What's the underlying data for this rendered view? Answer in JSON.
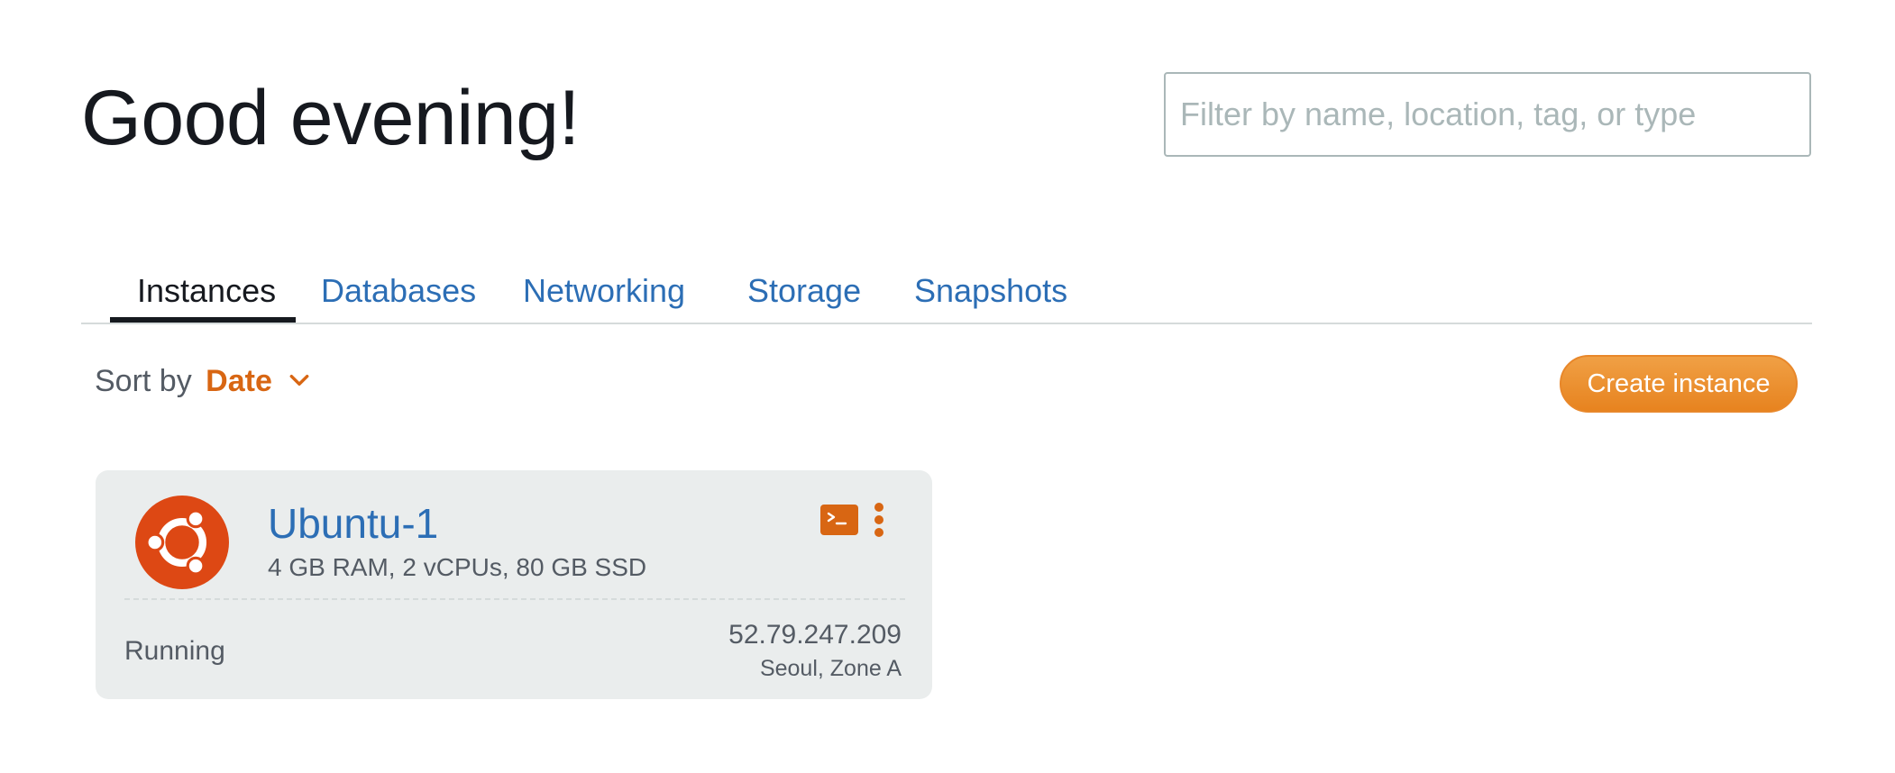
{
  "header": {
    "greeting": "Good evening!"
  },
  "filter": {
    "placeholder": "Filter by name, location, tag, or type",
    "value": ""
  },
  "tabs": [
    {
      "label": "Instances",
      "active": true
    },
    {
      "label": "Databases",
      "active": false
    },
    {
      "label": "Networking",
      "active": false
    },
    {
      "label": "Storage",
      "active": false
    },
    {
      "label": "Snapshots",
      "active": false
    }
  ],
  "sort": {
    "label": "Sort by",
    "value": "Date",
    "icon": "chevron-down-icon"
  },
  "actions": {
    "create_label": "Create instance"
  },
  "instances": [
    {
      "name": "Ubuntu-1",
      "specs": "4 GB RAM, 2 vCPUs, 80 GB SSD",
      "status": "Running",
      "ip": "52.79.247.209",
      "location": "Seoul, Zone A",
      "os_icon": "ubuntu-logo-icon",
      "connect_icon": "terminal-icon",
      "menu_icon": "more-vertical-icon"
    }
  ],
  "colors": {
    "accent_orange": "#d86613",
    "link_blue": "#2c6eb5",
    "card_bg": "#eaeded",
    "button_orange": "#ec8b2a",
    "ubuntu_orange": "#dd4814"
  }
}
